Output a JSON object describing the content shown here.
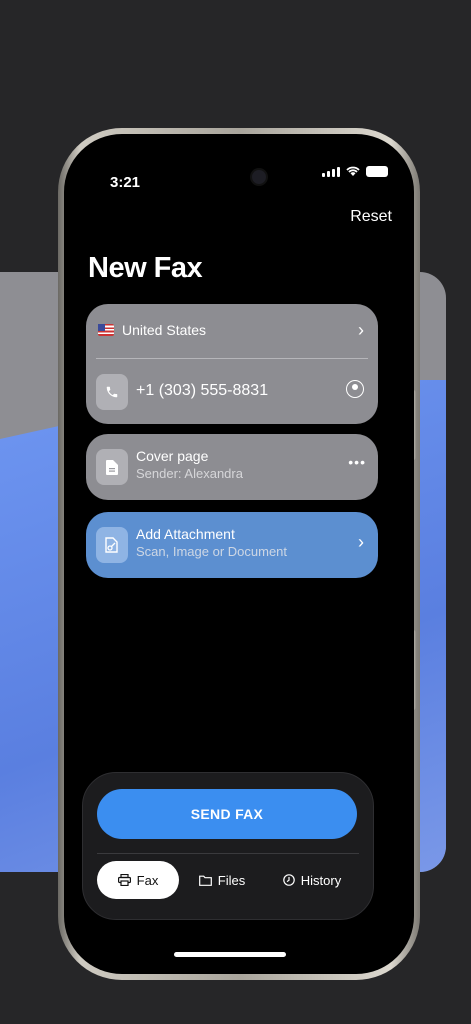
{
  "status_bar": {
    "time": "3:21"
  },
  "header": {
    "reset_label": "Reset",
    "title": "New Fax"
  },
  "recipient": {
    "country": "United States",
    "flag": "us-flag",
    "phone_number": "+1 (303) 555-8831"
  },
  "cover_page": {
    "title": "Cover page",
    "subtitle": "Sender: Alexandra"
  },
  "attachment": {
    "title": "Add Attachment",
    "subtitle": "Scan, Image or Document"
  },
  "actions": {
    "send_label": "SEND FAX"
  },
  "tabs": [
    {
      "label": "Fax",
      "icon": "printer-icon",
      "active": true
    },
    {
      "label": "Files",
      "icon": "folder-icon",
      "active": false
    },
    {
      "label": "History",
      "icon": "clock-icon",
      "active": false
    }
  ],
  "colors": {
    "accent": "#3b8ef0",
    "attachment_card": "#5c8fd0",
    "card": "#8d8d92"
  }
}
